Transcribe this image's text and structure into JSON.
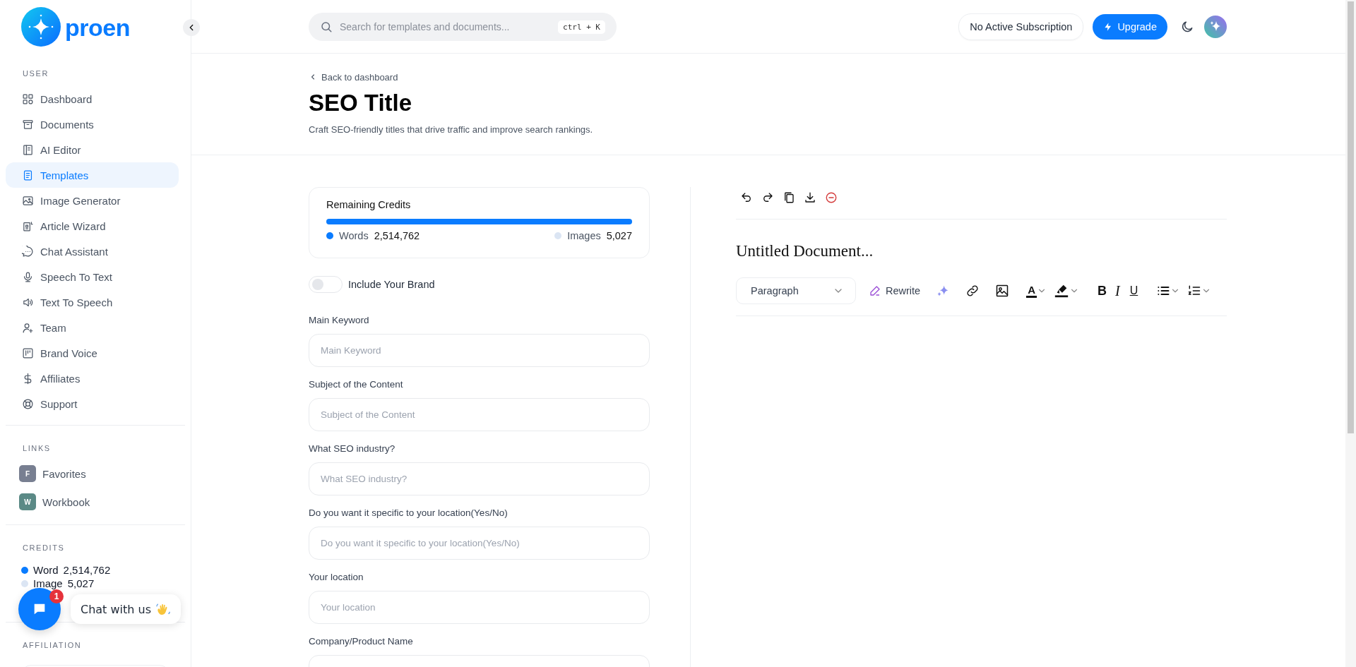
{
  "logo": {
    "text": "proen"
  },
  "sidebar": {
    "user_heading": "USER",
    "items": [
      {
        "label": "Dashboard",
        "selected": false
      },
      {
        "label": "Documents",
        "selected": false
      },
      {
        "label": "AI Editor",
        "selected": false
      },
      {
        "label": "Templates",
        "selected": true
      },
      {
        "label": "Image Generator",
        "selected": false
      },
      {
        "label": "Article Wizard",
        "selected": false
      },
      {
        "label": "Chat Assistant",
        "selected": false
      },
      {
        "label": "Speech To Text",
        "selected": false
      },
      {
        "label": "Text To Speech",
        "selected": false
      },
      {
        "label": "Team",
        "selected": false
      },
      {
        "label": "Brand Voice",
        "selected": false
      },
      {
        "label": "Affiliates",
        "selected": false
      },
      {
        "label": "Support",
        "selected": false
      }
    ],
    "links_heading": "LINKS",
    "links": [
      {
        "letter": "F",
        "label": "Favorites",
        "color": "#787f91"
      },
      {
        "letter": "W",
        "label": "Workbook",
        "color": "#5b8a86"
      }
    ],
    "credits_heading": "CREDITS",
    "credits": [
      {
        "label": "Word",
        "value": "2,514,762",
        "color": "#0a7cff"
      },
      {
        "label": "Image",
        "value": "5,027",
        "color": "#dbe5f3"
      }
    ],
    "affiliation_heading": "AFFILIATION"
  },
  "chat_widget": {
    "badge": "1",
    "label": "Chat with us"
  },
  "topbar": {
    "search": {
      "placeholder": "Search for templates and documents...",
      "shortcut": "ctrl + K"
    },
    "subscription": "No Active Subscription",
    "upgrade": "Upgrade"
  },
  "header": {
    "back": "Back to dashboard",
    "title": "SEO Title",
    "subtitle": "Craft SEO-friendly titles that drive traffic and improve search rankings."
  },
  "credits_card": {
    "title": "Remaining Credits",
    "level": 1,
    "items": [
      {
        "label": "Words",
        "value": "2,514,762",
        "color": "#0a7cff"
      },
      {
        "label": "Images",
        "value": "5,027",
        "color": "#dbe5f3"
      }
    ]
  },
  "brand_toggle": {
    "label": "Include Your Brand",
    "on": false
  },
  "fields": [
    {
      "label": "Main Keyword",
      "placeholder": "Main Keyword"
    },
    {
      "label": "Subject of the Content",
      "placeholder": "Subject of the Content"
    },
    {
      "label": "What SEO industry?",
      "placeholder": "What SEO industry?"
    },
    {
      "label": "Do you want it specific to your location(Yes/No)",
      "placeholder": "Do you want it specific to your location(Yes/No)"
    },
    {
      "label": "Your location",
      "placeholder": "Your location"
    },
    {
      "label": "Company/Product Name"
    }
  ],
  "editor": {
    "title": "Untitled Document...",
    "block_type": "Paragraph",
    "rewrite": "Rewrite",
    "text_color_glyph": "A",
    "format_buttons": [
      "B",
      "I",
      "U"
    ]
  }
}
